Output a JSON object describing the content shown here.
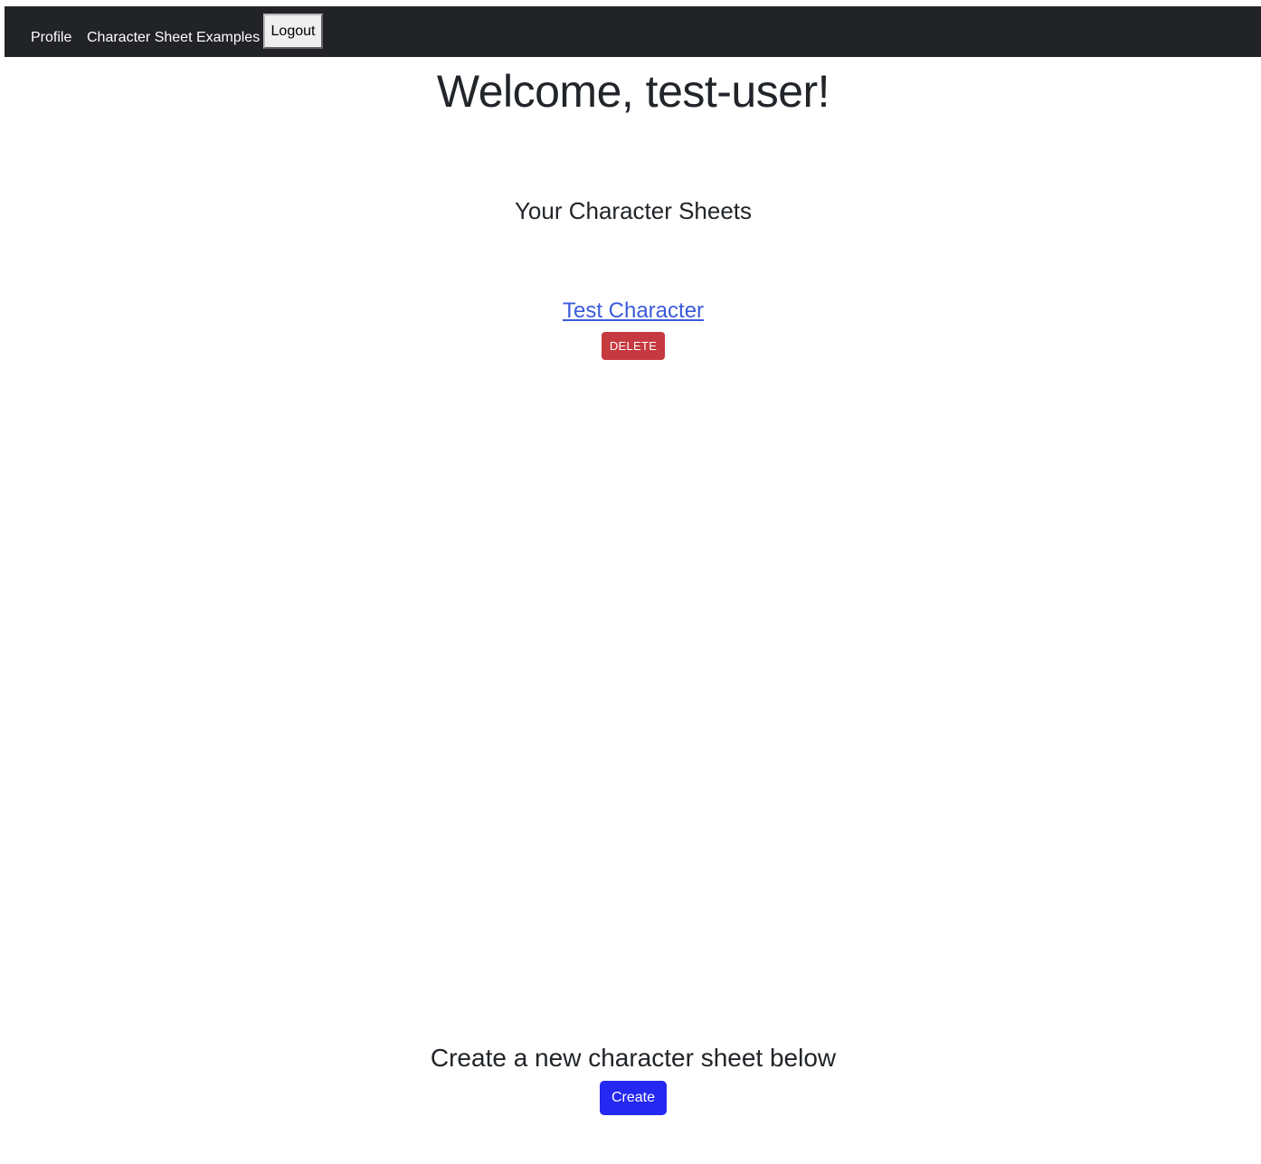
{
  "navbar": {
    "profile_label": "Profile",
    "examples_label": "Character Sheet Examples",
    "logout_label": "Logout"
  },
  "main": {
    "welcome_title": "Welcome, test-user!",
    "sheets_heading": "Your Character Sheets",
    "sheets": [
      {
        "name": "Test Character",
        "delete_label": "DELETE"
      }
    ],
    "create_heading": "Create a new character sheet below",
    "create_label": "Create"
  },
  "colors": {
    "navbar_bg": "#212327",
    "link": "#3b5bdb",
    "delete_button": "#c6393f",
    "create_button": "#2528f0"
  }
}
